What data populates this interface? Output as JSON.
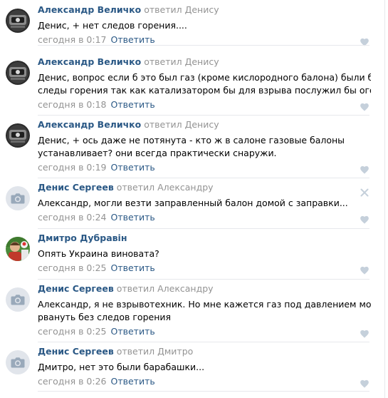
{
  "comments": [
    {
      "author": "Александр Величко",
      "reply_to": "ответил Денису",
      "lines": [
        "Денис, + нет следов горения...."
      ],
      "time": "сегодня в 0:17",
      "reply_label": "Ответить",
      "avatar": "dark-photo",
      "action_icon": "heart-icon"
    },
    {
      "author": "Александр Величко",
      "reply_to": "ответил Денису",
      "lines": [
        "Денис, вопрос если б это был газ (кроме кислородного балона) были бы",
        "следы горения так как катализатором бы для взрыва послужил бы огонь..."
      ],
      "time": "сегодня в 0:18",
      "reply_label": "Ответить",
      "avatar": "dark-photo",
      "action_icon": "heart-icon"
    },
    {
      "author": "Александр Величко",
      "reply_to": "ответил Денису",
      "lines": [
        "Денис, + ось даже не потянута - кто ж в салоне газовые балоны",
        "устанавливает? они всегда практически снаружи."
      ],
      "time": "сегодня в 0:19",
      "reply_label": "Ответить",
      "avatar": "dark-photo",
      "action_icon": "heart-icon"
    },
    {
      "author": "Денис Сергеев",
      "reply_to": "ответил Александру",
      "lines": [
        "Александр, могли везти заправленный балон домой с заправки..."
      ],
      "time": "сегодня в 0:24",
      "reply_label": "Ответить",
      "avatar": "camera-placeholder",
      "action_icon": "heart-icon",
      "has_close": true
    },
    {
      "author": "Дмитро Дубравін",
      "reply_to": "",
      "lines": [
        "Опять Украина виновата?"
      ],
      "time": "сегодня в 0:25",
      "reply_label": "Ответить",
      "avatar": "color-photo",
      "action_icon": "heart-icon"
    },
    {
      "author": "Денис Сергеев",
      "reply_to": "ответил Александру",
      "lines": [
        "Александр, я не взрывотехник. Но мне кажется газ под давлением мог",
        "рвануть без следов горения"
      ],
      "time": "сегодня в 0:25",
      "reply_label": "Ответить",
      "avatar": "camera-placeholder",
      "action_icon": "heart-icon"
    },
    {
      "author": "Денис Сергеев",
      "reply_to": "ответил Дмитро",
      "lines": [
        "Дмитро, нет это были барабашки..."
      ],
      "time": "сегодня в 0:26",
      "reply_label": "Ответить",
      "avatar": "camera-placeholder",
      "action_icon": "heart-icon"
    }
  ],
  "colors": {
    "author": "#2a5885",
    "muted": "#939393",
    "text": "#000000",
    "separator": "#e7e8ec",
    "icon": "#c5d0db",
    "placeholder_bg": "#e1e5eb"
  }
}
